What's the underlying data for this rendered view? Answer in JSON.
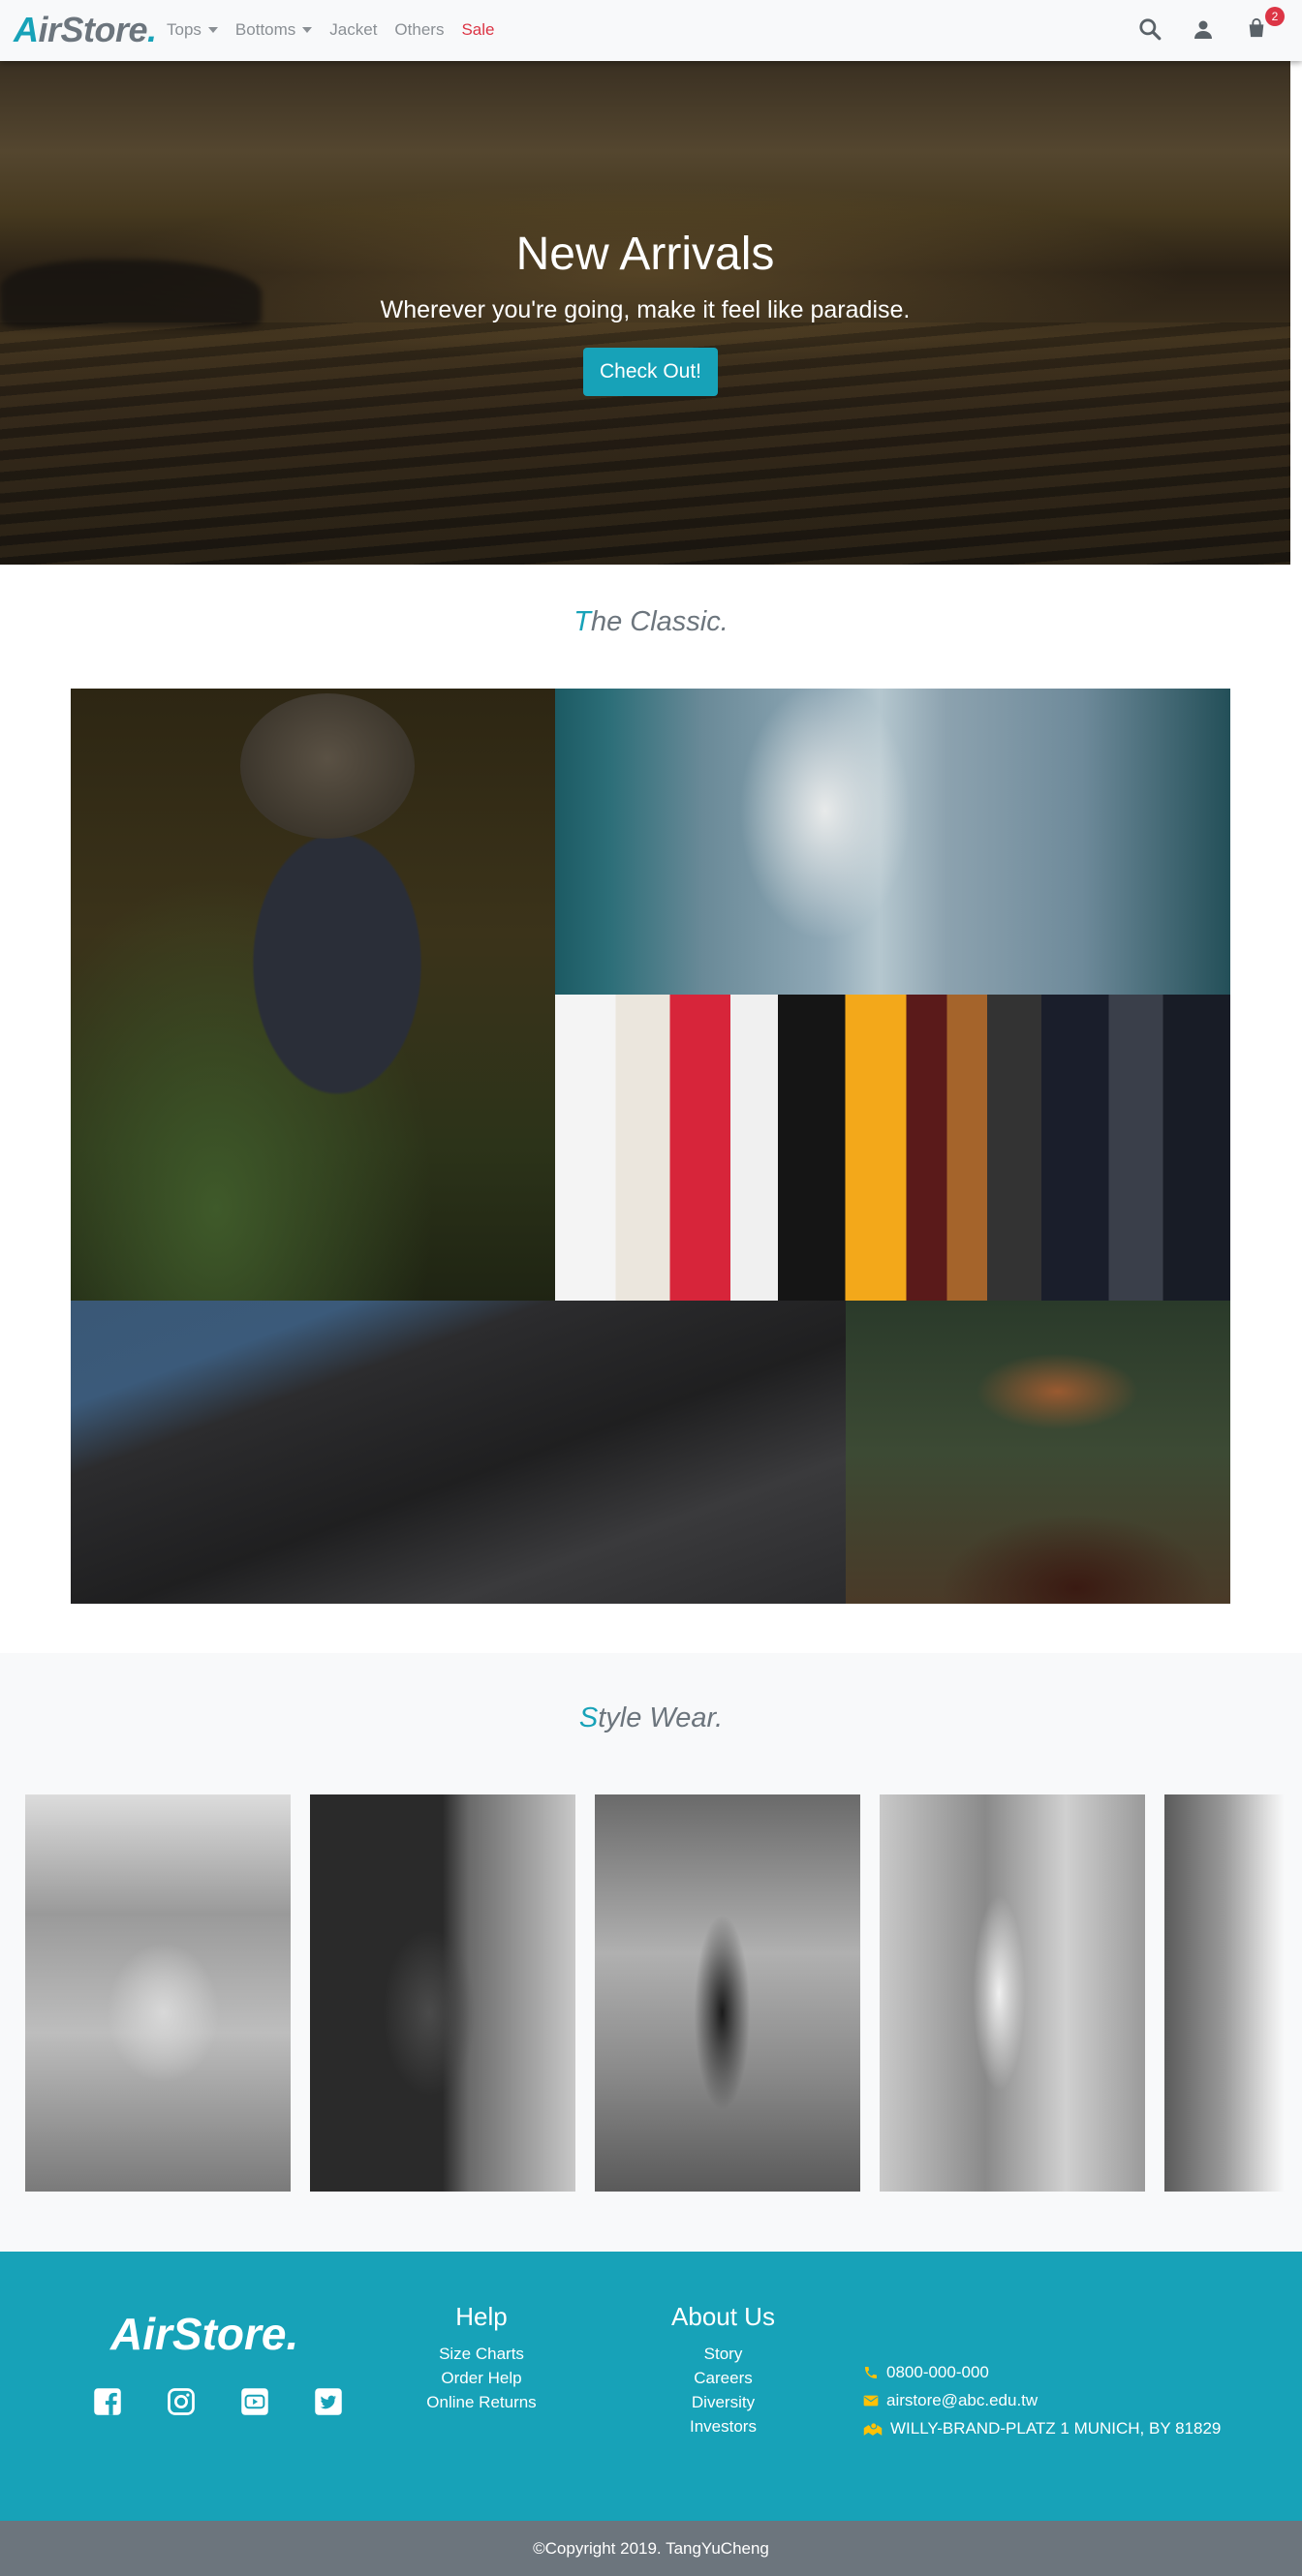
{
  "nav": {
    "brand_first": "A",
    "brand_rest": "irStore",
    "brand_dot": ".",
    "menu": [
      "Tops",
      "Bottoms",
      "Jacket",
      "Others",
      "Sale"
    ],
    "cart_count": "2",
    "icons": [
      "search-icon",
      "user-icon",
      "shopping-bag-icon"
    ]
  },
  "hero": {
    "title": "New Arrivals",
    "subtitle": "Wherever you're going, make it feel like paradise.",
    "button": "Check Out!"
  },
  "classic": {
    "title_first": "T",
    "title_rest": "he Classic."
  },
  "style_wear": {
    "title_first": "S",
    "title_rest": "tyle Wear."
  },
  "footer": {
    "brand": "AirStore.",
    "social": [
      "facebook-icon",
      "instagram-icon",
      "youtube-icon",
      "twitter-icon"
    ],
    "help": {
      "title": "Help",
      "links": [
        "Size Charts",
        "Order Help",
        "Online Returns"
      ]
    },
    "about": {
      "title": "About Us",
      "links": [
        "Story",
        "Careers",
        "Diversity",
        "Investors"
      ]
    },
    "contact": {
      "phone": "0800-000-000",
      "email": "airstore@abc.edu.tw",
      "address": "WILLY-BRAND-PLATZ 1 MUNICH, BY 81829"
    },
    "copyright": "©Copyright 2019. TangYuCheng"
  },
  "colors": {
    "accent": "#17a2b8",
    "muted": "#6c757d",
    "sale": "#dc3545",
    "contact_icon": "#ffc107"
  }
}
